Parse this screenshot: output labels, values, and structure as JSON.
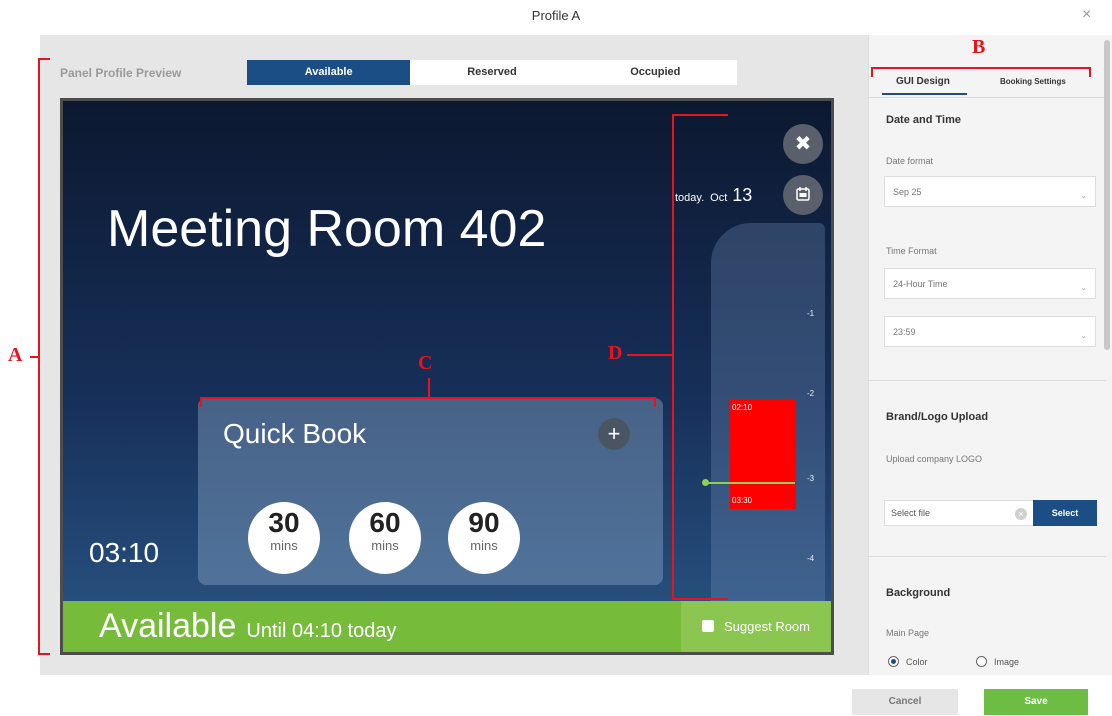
{
  "dialog": {
    "title": "Profile A",
    "close_icon": "×"
  },
  "preview": {
    "label": "Panel Profile Preview",
    "state_tabs": [
      {
        "label": "Available",
        "active": true
      },
      {
        "label": "Reserved",
        "active": false
      },
      {
        "label": "Occupied",
        "active": false
      }
    ]
  },
  "panel": {
    "room_name": "Meeting Room 402",
    "clock": "03:10",
    "date": {
      "today": "today.",
      "month": "Oct",
      "day": "13"
    },
    "tools_icon": "wrench-cross-icon",
    "calendar_icon": "calendar-icon",
    "quick_book": {
      "title": "Quick Book",
      "plus": "+",
      "durations": [
        {
          "value": "30",
          "unit": "mins"
        },
        {
          "value": "60",
          "unit": "mins"
        },
        {
          "value": "90",
          "unit": "mins"
        }
      ]
    },
    "timeline": {
      "ticks": [
        "-1",
        "-2",
        "-3",
        "-4"
      ],
      "booking": {
        "start": "02:10",
        "end": "03:30",
        "color": "#ff0000"
      }
    },
    "status": {
      "main": "Available",
      "sub": "Until 04:10 today",
      "color": "#77bb3a",
      "suggest_label": "Suggest Room"
    }
  },
  "annotations": {
    "a": "A",
    "b": "B",
    "c": "C",
    "d": "D",
    "color": "#e8141c"
  },
  "settings": {
    "tabs": [
      {
        "label": "GUI Design",
        "active": true
      },
      {
        "label": "Booking Settings",
        "active": false
      }
    ],
    "date_time": {
      "heading": "Date and Time",
      "date_format_label": "Date format",
      "date_format_value": "Sep 25",
      "time_format_label": "Time Format",
      "time_format_value": "24-Hour Time",
      "time_example": "23:59"
    },
    "brand": {
      "heading": "Brand/Logo Upload",
      "upload_label": "Upload company LOGO",
      "file_placeholder": "Select file",
      "select_button": "Select"
    },
    "background": {
      "heading": "Background",
      "main_page_label": "Main Page",
      "options": [
        {
          "label": "Color",
          "selected": true
        },
        {
          "label": "Image",
          "selected": false
        }
      ]
    }
  },
  "footer": {
    "cancel": "Cancel",
    "save": "Save"
  },
  "colors": {
    "accent": "#1c4e86",
    "save": "#6dbd45"
  }
}
